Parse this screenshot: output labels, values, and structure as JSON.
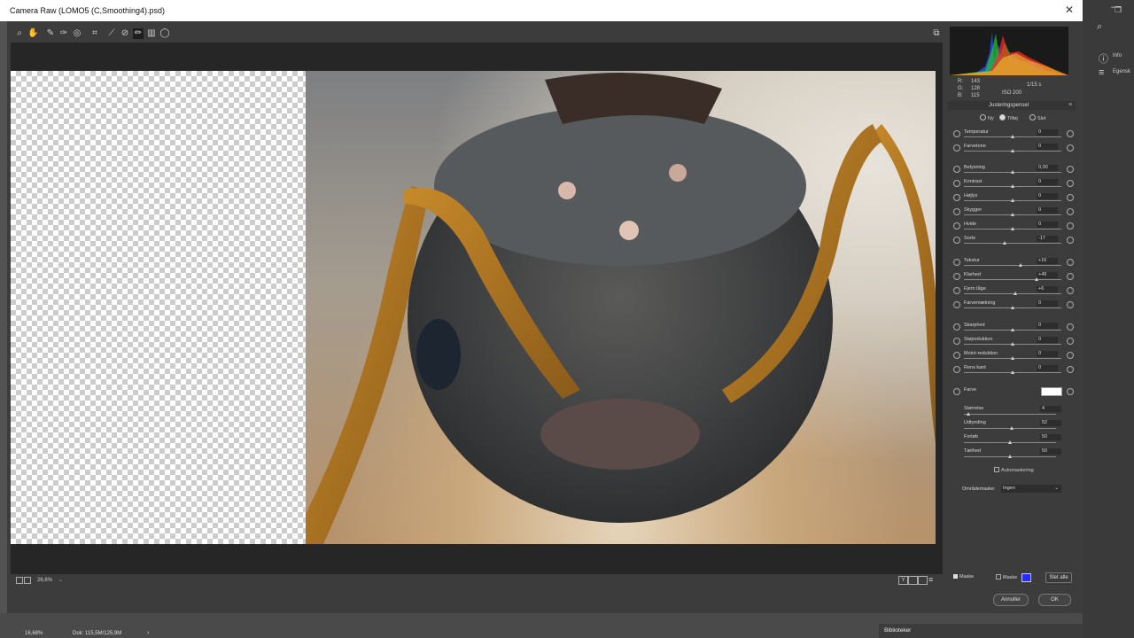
{
  "window": {
    "title": "Camera Raw (LOMO5 (C,Smoothing4).psd)"
  },
  "toolbar": {
    "tools": [
      "zoom-tool",
      "hand-tool",
      "white-balance-tool",
      "color-sampler-tool",
      "targeted-adjustment-tool",
      "crop-tool",
      "straighten-tool",
      "spot-removal-tool",
      "red-eye-tool",
      "adjustment-brush-tool",
      "graduated-filter-tool",
      "radial-filter-tool"
    ]
  },
  "preview": {
    "zoom": "26,6%"
  },
  "histogram": {
    "r_label": "R:",
    "r": "143",
    "g_label": "G:",
    "g": "128",
    "b_label": "B:",
    "b": "115",
    "shutter": "1/15 s",
    "iso": "ISO 200"
  },
  "panel": {
    "title": "Justeringspensel",
    "modes": {
      "new": "Ny",
      "add": "Tilføj",
      "erase": "Slet"
    },
    "adjustments": [
      {
        "label": "Temperatur",
        "value": "0",
        "pos": 0.5
      },
      {
        "label": "Farvetone",
        "value": "0",
        "pos": 0.5
      },
      {
        "label": "Belysning",
        "value": "0,00",
        "pos": 0.5
      },
      {
        "label": "Kontrast",
        "value": "0",
        "pos": 0.5
      },
      {
        "label": "Højlys",
        "value": "0",
        "pos": 0.5
      },
      {
        "label": "Skygger",
        "value": "0",
        "pos": 0.5
      },
      {
        "label": "Hvide",
        "value": "0",
        "pos": 0.5
      },
      {
        "label": "Sorte",
        "value": "-17",
        "pos": 0.415
      },
      {
        "label": "Tekstur",
        "value": "+16",
        "pos": 0.58
      },
      {
        "label": "Klarhed",
        "value": "+49",
        "pos": 0.745
      },
      {
        "label": "Fjern tåge",
        "value": "+6",
        "pos": 0.53
      },
      {
        "label": "Farvemætning",
        "value": "0",
        "pos": 0.5
      },
      {
        "label": "Skarphed",
        "value": "0",
        "pos": 0.5
      },
      {
        "label": "Støjreduktion",
        "value": "0",
        "pos": 0.5
      },
      {
        "label": "Moiré-reduktion",
        "value": "0",
        "pos": 0.5
      },
      {
        "label": "Rens kant",
        "value": "0",
        "pos": 0.5
      }
    ],
    "color_label": "Farve",
    "brush": [
      {
        "label": "Størrelse",
        "value": "4",
        "pos": 0.05
      },
      {
        "label": "Udtynding",
        "value": "52",
        "pos": 0.52
      },
      {
        "label": "Forløb",
        "value": "50",
        "pos": 0.5
      },
      {
        "label": "Tæthed",
        "value": "50",
        "pos": 0.5
      }
    ],
    "automask": "Automaskering",
    "range_mask_label": "Områdemaske:",
    "range_mask_value": "Ingen",
    "mask_label": "Maske",
    "mask_color_label": "Maske",
    "clear_all": "Slet alle"
  },
  "buttons": {
    "cancel": "Annuller",
    "ok": "OK"
  },
  "statusbar": {
    "zoom": "16,68%",
    "doc": "Dok: 115,5M/125,9M"
  },
  "ps_panels": {
    "info": "Info",
    "properties": "Egensk",
    "libraries": "Biblioteker"
  },
  "colors": {
    "mask_swatch": "#2a2aff",
    "accent": "#ffffff"
  }
}
